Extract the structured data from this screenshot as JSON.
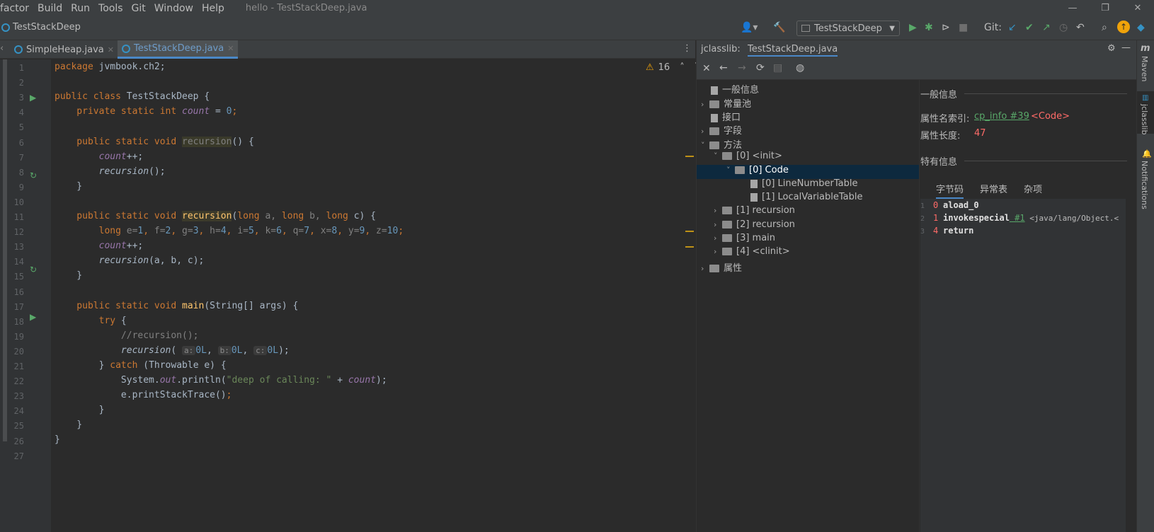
{
  "menu": {
    "items": [
      "factor",
      "Build",
      "Run",
      "Tools",
      "Git",
      "Window",
      "Help"
    ],
    "title": "hello - TestStackDeep.java"
  },
  "window": {
    "minimize": "—",
    "restore": "❐",
    "close": "✕"
  },
  "nav": {
    "project": "TestStackDeep",
    "run_config": "TestStackDeep",
    "git_label": "Git:"
  },
  "tabs": [
    {
      "label": "SimpleHeap.java"
    },
    {
      "label": "TestStackDeep.java",
      "active": true
    }
  ],
  "editor": {
    "warnings": "16",
    "lines": [
      "1",
      "2",
      "3",
      "4",
      "5",
      "6",
      "7",
      "8",
      "9",
      "10",
      "11",
      "12",
      "13",
      "14",
      "15",
      "16",
      "17",
      "18",
      "19",
      "20",
      "21",
      "22",
      "23",
      "24",
      "25",
      "26",
      "27"
    ]
  },
  "code": {
    "l1a": "package",
    "l1b": " jvmbook.ch2;",
    "l3a": "public class",
    "l3b": " TestStackDeep {",
    "l4a": "    private static int ",
    "l4b": "count",
    "l4c": " = ",
    "l4d": "0",
    "l4e": ";",
    "l6a": "    public static void ",
    "l6b": "recursion",
    "l6c": "() {",
    "l7a": "        ",
    "l7b": "count",
    "l7c": "++;",
    "l8a": "        ",
    "l8b": "recursion",
    "l8c": "();",
    "l9": "    }",
    "l11a": "    public static void ",
    "l11b": "recursion",
    "l11c": "(",
    "l11d": "long ",
    "l11e": "a, ",
    "l11f": "long ",
    "l11g": "b, ",
    "l11h": "long ",
    "l11i": "c) {",
    "l12a": "        long ",
    "l12b": "e=",
    "l12c": "1",
    ", ": "",
    "l12d": "f=",
    "l12e": "2",
    "l12f": "g=",
    "l12g": "3",
    "l12h": "h=",
    "l12i": "4",
    "l12j": "i=",
    "l12k": "5",
    "l12l": "k=",
    "l12m": "6",
    "l12n": "q=",
    "l12o": "7",
    "l12p": "x=",
    "l12q": "8",
    "l12r": "y=",
    "l12s": "9",
    "l12t": "z=",
    "l12u": "10",
    "l13a": "        ",
    "l13b": "count",
    "l13c": "++;",
    "l14a": "        ",
    "l14b": "recursion",
    "l14c": "(a, b, c);",
    "l15": "    }",
    "l17a": "    public static void ",
    "l17b": "main",
    "l17c": "(String[] args) {",
    "l18a": "        try ",
    "l18b": "{",
    "l19": "            //recursion();",
    "l20a": "            ",
    "l20b": "recursion",
    "l20c": "( ",
    "l20d": "a:",
    "l20e": "0L",
    "l20f": ", ",
    "l20g": "b:",
    "l20h": "0L",
    "l20i": ", ",
    "l20j": "c:",
    "l20k": "0L",
    "l20l": ");",
    "l21a": "        } ",
    "l21b": "catch",
    " l21c": "",
    "l21d": " (Throwable e) {",
    "l22a": "            System.",
    "l22b": "out",
    "l22c": ".println(",
    "l22d": "\"deep of calling: \"",
    "l22e": " + ",
    "l22f": "count",
    "l22g": ");",
    "l23a": "            e.printStackTrace()",
    "l23b": ";",
    "l24": "        }",
    "l25": "    }",
    "l26": "}"
  },
  "jclasslib": {
    "header": "jclasslib:",
    "tab": "TestStackDeep.java",
    "tree": [
      "一般信息",
      "常量池",
      "接口",
      "字段",
      "方法",
      "[0] <init>",
      "[0] Code",
      "[0] LineNumberTable",
      "[1] LocalVariableTable",
      "[1] recursion",
      "[2] recursion",
      "[3] main",
      "[4] <clinit>",
      "属性"
    ],
    "info": {
      "general": "一般信息",
      "name_index_label": "属性名索引:",
      "name_index_link": "cp_info #39",
      "name_index_value": "<Code>",
      "length_label": "属性长度:",
      "length_value": "47",
      "specific": "特有信息",
      "subtabs": [
        "字节码",
        "异常表",
        "杂项"
      ],
      "bytecode": [
        {
          "ln": "1",
          "off": "0",
          "op": "aload_0",
          "arg": "",
          "cmt": ""
        },
        {
          "ln": "2",
          "off": "1",
          "op": "invokespecial",
          "arg": "#1",
          "cmt": "<java/lang/Object.<"
        },
        {
          "ln": "3",
          "off": "4",
          "op": "return",
          "arg": "",
          "cmt": ""
        }
      ]
    }
  },
  "sidebar": {
    "maven": "Maven",
    "jclasslib": "jclasslib",
    "notifications": "Notifications"
  }
}
